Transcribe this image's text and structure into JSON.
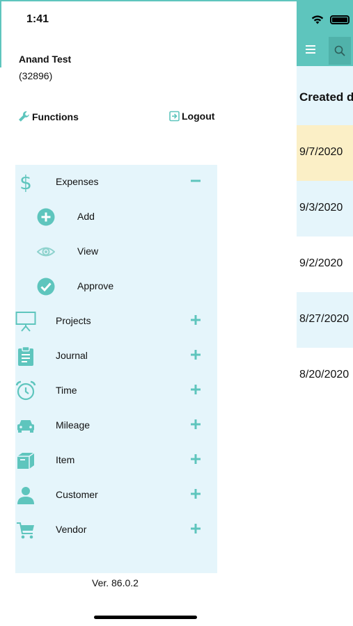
{
  "status_bar": {
    "time": "1:41"
  },
  "drawer": {
    "user_name": "Anand Test",
    "user_id": "(32896)",
    "functions_label": "Functions",
    "logout_label": "Logout",
    "menu": [
      {
        "label": "Expenses",
        "icon": "dollar-icon",
        "toggle": "minus",
        "expanded": true,
        "sub_items": [
          {
            "label": "Add",
            "icon": "plus-circle-icon"
          },
          {
            "label": "View",
            "icon": "eye-icon"
          },
          {
            "label": "Approve",
            "icon": "check-circle-icon"
          }
        ]
      },
      {
        "label": "Projects",
        "icon": "presentation-icon",
        "toggle": "plus"
      },
      {
        "label": "Journal",
        "icon": "clipboard-icon",
        "toggle": "plus"
      },
      {
        "label": "Time",
        "icon": "alarm-clock-icon",
        "toggle": "plus"
      },
      {
        "label": "Mileage",
        "icon": "car-icon",
        "toggle": "plus"
      },
      {
        "label": "Item",
        "icon": "box-icon",
        "toggle": "plus"
      },
      {
        "label": "Customer",
        "icon": "person-icon",
        "toggle": "plus"
      },
      {
        "label": "Vendor",
        "icon": "cart-icon",
        "toggle": "plus"
      }
    ],
    "version": "Ver. 86.0.2"
  },
  "background_list": {
    "column_header": "Created date",
    "rows": [
      "9/7/2020",
      "9/3/2020",
      "9/2/2020",
      "8/27/2020",
      "8/20/2020"
    ]
  },
  "colors": {
    "accent": "#5ec5bd",
    "panel": "#e5f5fb",
    "highlight_row": "#fbefc6"
  }
}
